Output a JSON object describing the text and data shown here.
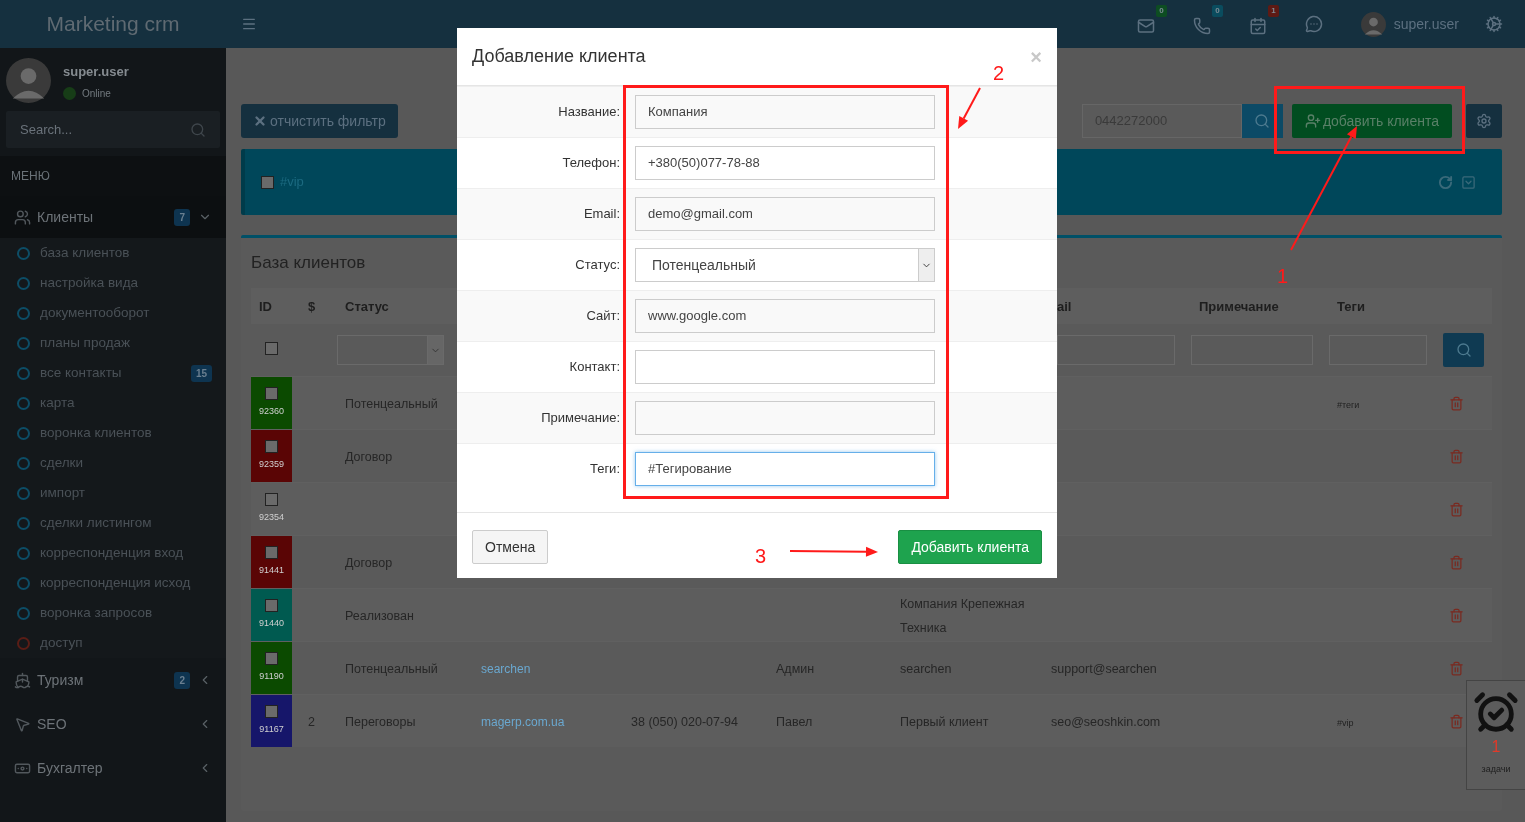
{
  "logo": "Marketing crm",
  "topbar": {
    "notifications": [
      {
        "count": "0",
        "color": "#0d4d22"
      },
      {
        "count": "0",
        "color": "#0a4c5e"
      },
      {
        "count": "1",
        "color": "#5e1a14"
      }
    ],
    "user": "super.user"
  },
  "sidebar": {
    "user": {
      "name": "super.user",
      "status": "Online"
    },
    "search_placeholder": "Search...",
    "menu_label": "МЕНЮ",
    "items": [
      {
        "label": "Клиенты",
        "badge": "7",
        "expanded": true,
        "children": [
          {
            "label": "база клиентов",
            "color": "#0d4d66"
          },
          {
            "label": "настройка вида",
            "color": "#0d4d66"
          },
          {
            "label": "документооборот",
            "color": "#0d4d66"
          },
          {
            "label": "планы продаж",
            "color": "#0d4d66"
          },
          {
            "label": "все контакты",
            "color": "#0d4d66",
            "badge": "15"
          },
          {
            "label": "карта",
            "color": "#0d4d66"
          },
          {
            "label": "воронка клиентов",
            "color": "#0d4d66"
          },
          {
            "label": "сделки",
            "color": "#0d4d66"
          },
          {
            "label": "импорт",
            "color": "#0d4d66"
          },
          {
            "label": "сделки листингом",
            "color": "#0d4d66"
          },
          {
            "label": "корреспонденция вход",
            "color": "#0d4d66"
          },
          {
            "label": "корреспонденция исход",
            "color": "#0d4d66"
          },
          {
            "label": "воронка запросов",
            "color": "#0d4d66"
          },
          {
            "label": "доступ",
            "color": "#5a1d16"
          }
        ]
      },
      {
        "label": "Туризм",
        "badge": "2",
        "expanded": false
      },
      {
        "label": "SEO",
        "expanded": false
      },
      {
        "label": "Бухгалтер",
        "expanded": false
      }
    ]
  },
  "toolbar": {
    "clear_filter": "отчистить фильтр",
    "phone_search": "0442272000",
    "add_client": "добавить клиента"
  },
  "tag_filter": [
    {
      "label": "#vip",
      "checked": false
    }
  ],
  "clients": {
    "title": "База клиентов",
    "select_all_checked": false,
    "columns": [
      "ID",
      "$",
      "Статус",
      "",
      "",
      "",
      "",
      "ail",
      "Примечание",
      "Теги",
      ""
    ],
    "rows": [
      {
        "color": "#0b4a00",
        "checked": false,
        "cells": [
          "92360",
          "",
          "Потенцеальный",
          "",
          "",
          "",
          "",
          "",
          "",
          "#теги"
        ]
      },
      {
        "color": "#5a0505",
        "checked": false,
        "cells": [
          "92359",
          "",
          "Договор",
          "",
          "",
          "",
          "",
          "",
          "",
          ""
        ]
      },
      {
        "checked": false,
        "cells": [
          "92354",
          "",
          "",
          "",
          "",
          "",
          "",
          "",
          "",
          ""
        ]
      },
      {
        "color": "#5a0505",
        "checked": false,
        "cells": [
          "91441",
          "",
          "Договор",
          "",
          "",
          "",
          "",
          "",
          "",
          ""
        ]
      },
      {
        "color": "#005a50",
        "checked": false,
        "cells": [
          "91440",
          "",
          "Реализован",
          "",
          "",
          "",
          "Компания Крепежная Техника",
          "",
          "",
          ""
        ]
      },
      {
        "color": "#0b4a00",
        "checked": false,
        "cells": [
          "91190",
          "",
          "Потенцеальный",
          "searchen",
          "",
          "Админ",
          "searchen",
          "support@searchen",
          "",
          ""
        ]
      },
      {
        "color": "#16166a",
        "checked": false,
        "cells": [
          "91167",
          "2",
          "Переговоры",
          "magerp.com.ua",
          "38 (050) 020-07-94",
          "Павел",
          "Первый клиент",
          "seo@seoshkin.com",
          "",
          "#vip"
        ]
      }
    ]
  },
  "tasks": {
    "count": "1",
    "label": "задачи"
  },
  "modal": {
    "title": "Добавление клиента",
    "close": "×",
    "fields": [
      {
        "label": "Название:",
        "kind": "text",
        "value": "Компания",
        "focused": false
      },
      {
        "label": "Телефон:",
        "kind": "text",
        "value": "+380(50)077-78-88",
        "focused": false
      },
      {
        "label": "Email:",
        "kind": "text",
        "value": "demo@gmail.com",
        "focused": false
      },
      {
        "label": "Статус:",
        "kind": "select",
        "value": "Потенцеальный",
        "focused": false
      },
      {
        "label": "Сайт:",
        "kind": "text",
        "value": "www.google.com",
        "focused": false
      },
      {
        "label": "Контакт:",
        "kind": "text",
        "focused": false
      },
      {
        "label": "Примечание:",
        "kind": "text",
        "focused": false
      },
      {
        "label": "Теги:",
        "kind": "text",
        "value": "#Тегирование",
        "focused": true
      }
    ],
    "cancel": "Отмена",
    "submit": "Добавить клиента"
  },
  "annotations": [
    "1",
    "2",
    "3"
  ]
}
